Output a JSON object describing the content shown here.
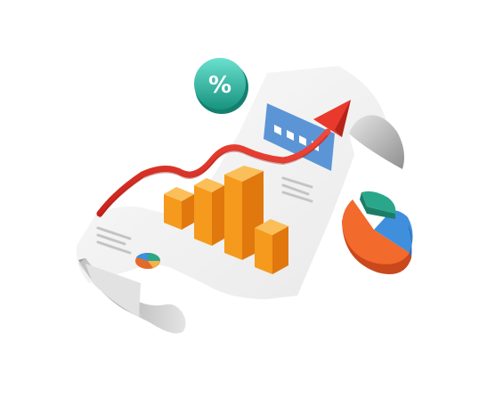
{
  "illustration": {
    "badge_symbol": "%",
    "colors": {
      "paper": "#f4f4f4",
      "paper_shadow": "#c9c9c9",
      "bar_front": "#f59a1c",
      "bar_side": "#e0780e",
      "bar_top": "#fbbf5a",
      "arrow": "#e23b2e",
      "banner": "#5b95d6",
      "badge_top": "#5ad3c4",
      "badge_bottom": "#1f9e8c",
      "pie_orange": "#f26a2c",
      "pie_blue": "#3f8fdc",
      "pie_green": "#2aa78a"
    },
    "icons": [
      "percent-badge-icon",
      "pie-chart-icon",
      "bar-chart-icon",
      "trend-arrow-icon",
      "document-icon"
    ]
  }
}
